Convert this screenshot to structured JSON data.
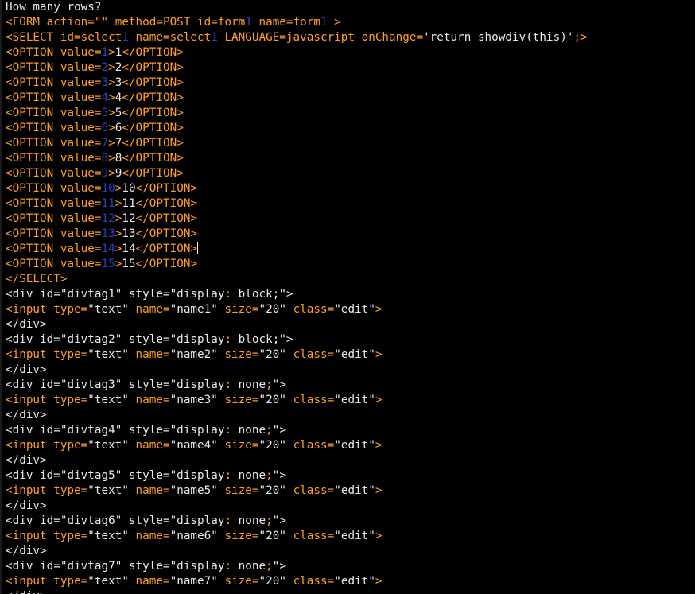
{
  "editor": {
    "lines": [
      [
        {
          "t": "How many rows?",
          "c": "white"
        }
      ],
      [
        {
          "t": "<FORM action=\"\" method=POST id=form",
          "c": "orange"
        },
        {
          "t": "1",
          "c": "blue"
        },
        {
          "t": " name=form",
          "c": "orange"
        },
        {
          "t": "1",
          "c": "blue"
        },
        {
          "t": " >",
          "c": "orange"
        }
      ],
      [
        {
          "t": "<SELECT id=select",
          "c": "orange"
        },
        {
          "t": "1",
          "c": "blue"
        },
        {
          "t": " name=select",
          "c": "orange"
        },
        {
          "t": "1",
          "c": "blue"
        },
        {
          "t": " LANGUAGE=javascript onChange=",
          "c": "orange"
        },
        {
          "t": "'return showdiv(this)'",
          "c": "white"
        },
        {
          "t": ";>",
          "c": "orange"
        }
      ],
      [
        {
          "t": "<OPTION value=",
          "c": "orange"
        },
        {
          "t": "1",
          "c": "blue"
        },
        {
          "t": ">",
          "c": "orange"
        },
        {
          "t": "1",
          "c": "white"
        },
        {
          "t": "</OPTION>",
          "c": "orange"
        }
      ],
      [
        {
          "t": "<OPTION value=",
          "c": "orange"
        },
        {
          "t": "2",
          "c": "blue"
        },
        {
          "t": ">",
          "c": "orange"
        },
        {
          "t": "2",
          "c": "white"
        },
        {
          "t": "</OPTION>",
          "c": "orange"
        }
      ],
      [
        {
          "t": "<OPTION value=",
          "c": "orange"
        },
        {
          "t": "3",
          "c": "blue"
        },
        {
          "t": ">",
          "c": "orange"
        },
        {
          "t": "3",
          "c": "white"
        },
        {
          "t": "</OPTION>",
          "c": "orange"
        }
      ],
      [
        {
          "t": "<OPTION value=",
          "c": "orange"
        },
        {
          "t": "4",
          "c": "blue"
        },
        {
          "t": ">",
          "c": "orange"
        },
        {
          "t": "4",
          "c": "white"
        },
        {
          "t": "</OPTION>",
          "c": "orange"
        }
      ],
      [
        {
          "t": "<OPTION value=",
          "c": "orange"
        },
        {
          "t": "5",
          "c": "blue"
        },
        {
          "t": ">",
          "c": "orange"
        },
        {
          "t": "5",
          "c": "white"
        },
        {
          "t": "</OPTION>",
          "c": "orange"
        }
      ],
      [
        {
          "t": "<OPTION value=",
          "c": "orange"
        },
        {
          "t": "6",
          "c": "blue"
        },
        {
          "t": ">",
          "c": "orange"
        },
        {
          "t": "6",
          "c": "white"
        },
        {
          "t": "</OPTION>",
          "c": "orange"
        }
      ],
      [
        {
          "t": "<OPTION value=",
          "c": "orange"
        },
        {
          "t": "7",
          "c": "blue"
        },
        {
          "t": ">",
          "c": "orange"
        },
        {
          "t": "7",
          "c": "white"
        },
        {
          "t": "</OPTION>",
          "c": "orange"
        }
      ],
      [
        {
          "t": "<OPTION value=",
          "c": "orange"
        },
        {
          "t": "8",
          "c": "blue"
        },
        {
          "t": ">",
          "c": "orange"
        },
        {
          "t": "8",
          "c": "white"
        },
        {
          "t": "</OPTION>",
          "c": "orange"
        }
      ],
      [
        {
          "t": "<OPTION value=",
          "c": "orange"
        },
        {
          "t": "9",
          "c": "blue"
        },
        {
          "t": ">",
          "c": "orange"
        },
        {
          "t": "9",
          "c": "white"
        },
        {
          "t": "</OPTION>",
          "c": "orange"
        }
      ],
      [
        {
          "t": "<OPTION value=",
          "c": "orange"
        },
        {
          "t": "10",
          "c": "blue"
        },
        {
          "t": ">",
          "c": "orange"
        },
        {
          "t": "10",
          "c": "white"
        },
        {
          "t": "</OPTION>",
          "c": "orange"
        }
      ],
      [
        {
          "t": "<OPTION value=",
          "c": "orange"
        },
        {
          "t": "11",
          "c": "blue"
        },
        {
          "t": ">",
          "c": "orange"
        },
        {
          "t": "11",
          "c": "white"
        },
        {
          "t": "</OPTION>",
          "c": "orange"
        }
      ],
      [
        {
          "t": "<OPTION value=",
          "c": "orange"
        },
        {
          "t": "12",
          "c": "blue"
        },
        {
          "t": ">",
          "c": "orange"
        },
        {
          "t": "12",
          "c": "white"
        },
        {
          "t": "</OPTION>",
          "c": "orange"
        }
      ],
      [
        {
          "t": "<OPTION value=",
          "c": "orange"
        },
        {
          "t": "13",
          "c": "blue"
        },
        {
          "t": ">",
          "c": "orange"
        },
        {
          "t": "13",
          "c": "white"
        },
        {
          "t": "</OPTION>",
          "c": "orange"
        }
      ],
      [
        {
          "t": "<OPTION value=",
          "c": "orange"
        },
        {
          "t": "14",
          "c": "blue"
        },
        {
          "t": ">",
          "c": "orange"
        },
        {
          "t": "14",
          "c": "white"
        },
        {
          "t": "</OPTION>",
          "c": "orange"
        },
        {
          "caret": true
        }
      ],
      [
        {
          "t": "<OPTION value=",
          "c": "orange"
        },
        {
          "t": "15",
          "c": "blue"
        },
        {
          "t": ">",
          "c": "orange"
        },
        {
          "t": "15",
          "c": "white"
        },
        {
          "t": "</OPTION>",
          "c": "orange"
        }
      ],
      [
        {
          "t": "</SELECT>",
          "c": "orange"
        }
      ],
      [
        {
          "t": "<div id=\"divtag1\" style=\"display",
          "c": "white"
        },
        {
          "t": ":",
          "c": "orange"
        },
        {
          "t": " block",
          "c": "white"
        },
        {
          "t": ";\">",
          "c": "white"
        }
      ],
      [
        {
          "t": "<input type=",
          "c": "orange"
        },
        {
          "t": "\"text\"",
          "c": "white"
        },
        {
          "t": " name=",
          "c": "orange"
        },
        {
          "t": "\"name1\"",
          "c": "white"
        },
        {
          "t": " size=",
          "c": "orange"
        },
        {
          "t": "\"20\"",
          "c": "white"
        },
        {
          "t": " class=",
          "c": "orange"
        },
        {
          "t": "\"edit\"",
          "c": "white"
        },
        {
          "t": ">",
          "c": "orange"
        }
      ],
      [
        {
          "t": "</div>",
          "c": "white"
        }
      ],
      [
        {
          "t": "<div id=\"divtag2\" style=\"display",
          "c": "white"
        },
        {
          "t": ":",
          "c": "orange"
        },
        {
          "t": " block",
          "c": "white"
        },
        {
          "t": ";\">",
          "c": "white"
        }
      ],
      [
        {
          "t": "<input type=",
          "c": "orange"
        },
        {
          "t": "\"text\"",
          "c": "white"
        },
        {
          "t": " name=",
          "c": "orange"
        },
        {
          "t": "\"name2\"",
          "c": "white"
        },
        {
          "t": " size=",
          "c": "orange"
        },
        {
          "t": "\"20\"",
          "c": "white"
        },
        {
          "t": " class=",
          "c": "orange"
        },
        {
          "t": "\"edit\"",
          "c": "white"
        },
        {
          "t": ">",
          "c": "orange"
        }
      ],
      [
        {
          "t": "</div>",
          "c": "white"
        }
      ],
      [
        {
          "t": "<div id=\"divtag3\" style=\"display",
          "c": "white"
        },
        {
          "t": ":",
          "c": "orange"
        },
        {
          "t": " none",
          "c": "white"
        },
        {
          "t": ";",
          "c": "orange"
        },
        {
          "t": "\">",
          "c": "white"
        }
      ],
      [
        {
          "t": "<input type=",
          "c": "orange"
        },
        {
          "t": "\"text\"",
          "c": "white"
        },
        {
          "t": " name=",
          "c": "orange"
        },
        {
          "t": "\"name3\"",
          "c": "white"
        },
        {
          "t": " size=",
          "c": "orange"
        },
        {
          "t": "\"20\"",
          "c": "white"
        },
        {
          "t": " class=",
          "c": "orange"
        },
        {
          "t": "\"edit\"",
          "c": "white"
        },
        {
          "t": ">",
          "c": "orange"
        }
      ],
      [
        {
          "t": "</div>",
          "c": "white"
        }
      ],
      [
        {
          "t": "<div id=\"divtag4\" style=\"display",
          "c": "white"
        },
        {
          "t": ":",
          "c": "orange"
        },
        {
          "t": " none",
          "c": "white"
        },
        {
          "t": ";",
          "c": "orange"
        },
        {
          "t": "\">",
          "c": "white"
        }
      ],
      [
        {
          "t": "<input type=",
          "c": "orange"
        },
        {
          "t": "\"text\"",
          "c": "white"
        },
        {
          "t": " name=",
          "c": "orange"
        },
        {
          "t": "\"name4\"",
          "c": "white"
        },
        {
          "t": " size=",
          "c": "orange"
        },
        {
          "t": "\"20\"",
          "c": "white"
        },
        {
          "t": " class=",
          "c": "orange"
        },
        {
          "t": "\"edit\"",
          "c": "white"
        },
        {
          "t": ">",
          "c": "orange"
        }
      ],
      [
        {
          "t": "</div>",
          "c": "white"
        }
      ],
      [
        {
          "t": "<div id=\"divtag5\" style=\"display",
          "c": "white"
        },
        {
          "t": ":",
          "c": "orange"
        },
        {
          "t": " none",
          "c": "white"
        },
        {
          "t": ";",
          "c": "orange"
        },
        {
          "t": "\">",
          "c": "white"
        }
      ],
      [
        {
          "t": "<input type=",
          "c": "orange"
        },
        {
          "t": "\"text\"",
          "c": "white"
        },
        {
          "t": " name=",
          "c": "orange"
        },
        {
          "t": "\"name5\"",
          "c": "white"
        },
        {
          "t": " size=",
          "c": "orange"
        },
        {
          "t": "\"20\"",
          "c": "white"
        },
        {
          "t": " class=",
          "c": "orange"
        },
        {
          "t": "\"edit\"",
          "c": "white"
        },
        {
          "t": ">",
          "c": "orange"
        }
      ],
      [
        {
          "t": "</div>",
          "c": "white"
        }
      ],
      [
        {
          "t": "<div id=\"divtag6\" style=\"display",
          "c": "white"
        },
        {
          "t": ":",
          "c": "orange"
        },
        {
          "t": " none",
          "c": "white"
        },
        {
          "t": ";",
          "c": "orange"
        },
        {
          "t": "\">",
          "c": "white"
        }
      ],
      [
        {
          "t": "<input type=",
          "c": "orange"
        },
        {
          "t": "\"text\"",
          "c": "white"
        },
        {
          "t": " name=",
          "c": "orange"
        },
        {
          "t": "\"name6\"",
          "c": "white"
        },
        {
          "t": " size=",
          "c": "orange"
        },
        {
          "t": "\"20\"",
          "c": "white"
        },
        {
          "t": " class=",
          "c": "orange"
        },
        {
          "t": "\"edit\"",
          "c": "white"
        },
        {
          "t": ">",
          "c": "orange"
        }
      ],
      [
        {
          "t": "</div>",
          "c": "white"
        }
      ],
      [
        {
          "t": "<div id=\"divtag7\" style=\"display",
          "c": "white"
        },
        {
          "t": ":",
          "c": "orange"
        },
        {
          "t": " none",
          "c": "white"
        },
        {
          "t": ";",
          "c": "orange"
        },
        {
          "t": "\">",
          "c": "white"
        }
      ],
      [
        {
          "t": "<input type=",
          "c": "orange"
        },
        {
          "t": "\"text\"",
          "c": "white"
        },
        {
          "t": " name=",
          "c": "orange"
        },
        {
          "t": "\"name7\"",
          "c": "white"
        },
        {
          "t": " size=",
          "c": "orange"
        },
        {
          "t": "\"20\"",
          "c": "white"
        },
        {
          "t": " class=",
          "c": "orange"
        },
        {
          "t": "\"edit\"",
          "c": "white"
        },
        {
          "t": ">",
          "c": "orange"
        }
      ],
      [
        {
          "t": "</div>",
          "c": "white"
        }
      ]
    ]
  },
  "colors": {
    "background": "#000000",
    "tag": "#ff9e20",
    "text": "#e8e8e8",
    "number": "#2c3ec8"
  }
}
